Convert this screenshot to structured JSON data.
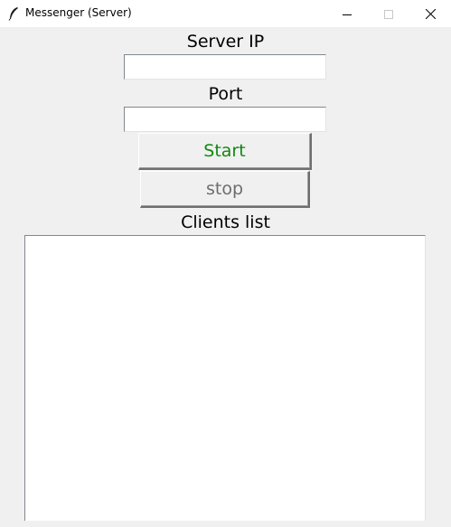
{
  "window": {
    "title": "Messenger (Server)",
    "icon": "feather-icon"
  },
  "title_controls": {
    "minimize_icon": "minimize-icon",
    "maximize_icon": "maximize-icon",
    "close_icon": "close-icon"
  },
  "form": {
    "server_ip_label": "Server IP",
    "server_ip_value": "",
    "port_label": "Port",
    "port_value": "",
    "start_label": "Start",
    "start_color": "#118811",
    "stop_label": "stop",
    "stop_color": "#6d6d6d",
    "clients_label": "Clients list",
    "clients": []
  }
}
